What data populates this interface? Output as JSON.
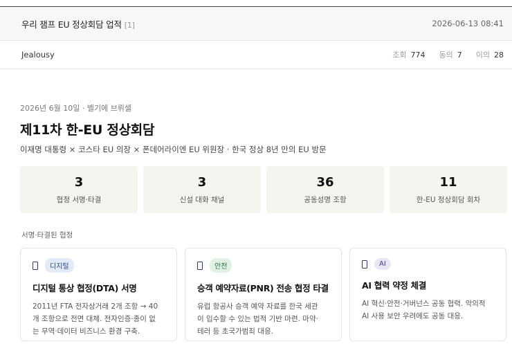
{
  "post": {
    "title": "우리 잼프 EU 정상회담 업적",
    "comment_count": "[1]",
    "datetime": "2026-06-13 08:41",
    "author": "Jealousy",
    "stats": {
      "views_label": "조회",
      "views": "774",
      "agree_label": "동의",
      "agree": "7",
      "disagree_label": "이의",
      "disagree": "28"
    }
  },
  "summit": {
    "date_location": "2026년 6월 10일 · 벨기에 브뤼셀",
    "title": "제11차 한-EU 정상회담",
    "subtitle": "이재명 대통령 × 코스타 EU 의장 × 폰데어라이엔 EU 위원장 · 한국 정상 8년 만의 EU 방문"
  },
  "kpis": [
    {
      "value": "3",
      "label": "협정 서명·타결"
    },
    {
      "value": "3",
      "label": "신설 대화 채널"
    },
    {
      "value": "36",
      "label": "공동성명 조항"
    },
    {
      "value": "11",
      "label": "한-EU 정상회담 회차"
    }
  ],
  "agreements": {
    "section_label": "서명·타결된 협정",
    "cards": [
      {
        "tag": "디지털",
        "tag_color": "#e3ebf7",
        "title": "디지털 통상 협정(DTA) 서명",
        "desc": [
          "2011년 FTA 전자상거래 2개 조항 → 40",
          "개 조항으로 전면 대체. 전자인증·종이 없",
          "는 무역·데이터 비즈니스 환경 구축."
        ]
      },
      {
        "tag": "안전",
        "tag_color": "#e2f1e6",
        "title": "승객 예약자료(PNR) 전송 협정 타결",
        "desc": [
          "유럽 항공사 승객 예약 자료를 한국 세관",
          "이 입수할 수 있는 법적 기반 마련. 마약·",
          "테러 등 초국가범죄 대응."
        ]
      },
      {
        "tag": "AI",
        "tag_color": "#ebe6f6",
        "title": "AI 협력 약정 체결",
        "desc": [
          "AI 혁신·안전·거버넌스 공동 협력. 악의적",
          "AI 사용 보안 우려에도 공동 대응."
        ]
      }
    ]
  }
}
